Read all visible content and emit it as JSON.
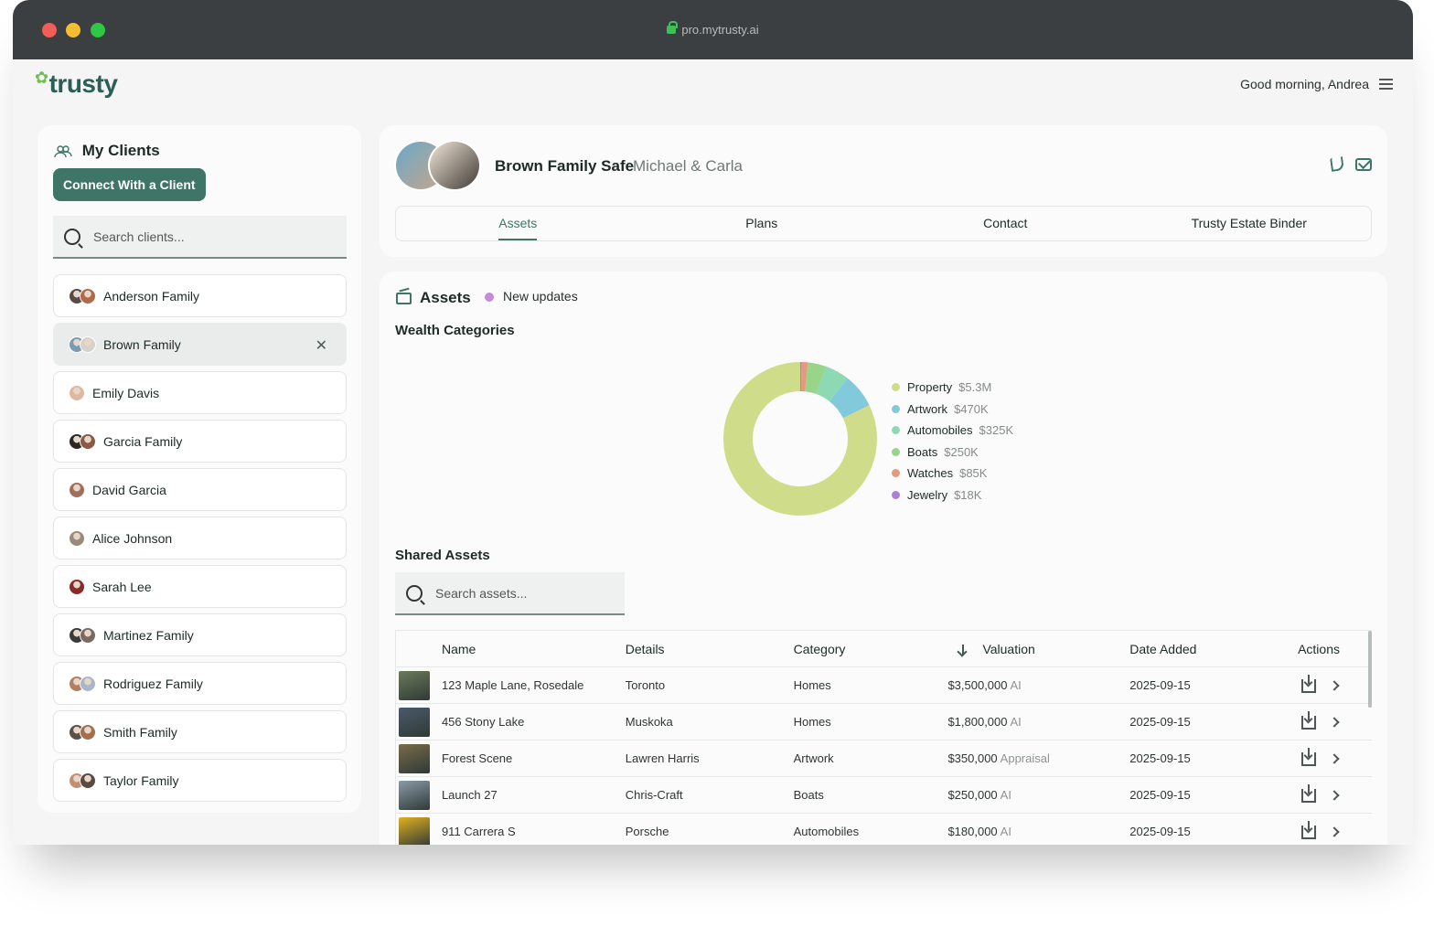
{
  "browser": {
    "url": "pro.mytrusty.ai"
  },
  "header": {
    "logo": "trusty",
    "greeting": "Good morning, Andrea"
  },
  "sidebar": {
    "title": "My Clients",
    "connect_label": "Connect With a Client",
    "search_placeholder": "Search clients...",
    "clients": [
      {
        "name": "Anderson Family",
        "avatars": [
          "#5a4a42",
          "#b06a4a"
        ]
      },
      {
        "name": "Brown Family",
        "avatars": [
          "#7b9bb0",
          "#d8d2c8"
        ],
        "active": true
      },
      {
        "name": "Emily Davis",
        "avatars": [
          "#e0b8a0"
        ]
      },
      {
        "name": "Garcia Family",
        "avatars": [
          "#2b2624",
          "#8a5a48"
        ]
      },
      {
        "name": "David Garcia",
        "avatars": [
          "#a0705a"
        ]
      },
      {
        "name": "Alice Johnson",
        "avatars": [
          "#9a8a7a"
        ]
      },
      {
        "name": "Sarah Lee",
        "avatars": [
          "#8a2a2a"
        ]
      },
      {
        "name": "Martinez Family",
        "avatars": [
          "#3a3a3a",
          "#7a6a60"
        ]
      },
      {
        "name": "Rodriguez Family",
        "avatars": [
          "#b08060",
          "#a8b8c8"
        ]
      },
      {
        "name": "Smith Family",
        "avatars": [
          "#5a5048",
          "#a07050"
        ]
      },
      {
        "name": "Taylor Family",
        "avatars": [
          "#c09070",
          "#5a4a40"
        ]
      }
    ]
  },
  "profile": {
    "title": "Brown Family Safe",
    "subtitle": "Michael & Carla",
    "tabs": [
      "Assets",
      "Plans",
      "Contact",
      "Trusty Estate Binder"
    ],
    "active_tab": "Assets"
  },
  "assets": {
    "title": "Assets",
    "badge": "New updates",
    "wealth_title": "Wealth Categories",
    "shared_title": "Shared Assets",
    "search_placeholder": "Search assets...",
    "columns": [
      "Name",
      "Details",
      "Category",
      "Valuation",
      "Date Added",
      "Actions"
    ],
    "rows": [
      {
        "name": "123 Maple Lane, Rosedale",
        "details": "Toronto",
        "category": "Homes",
        "valuation": "$3,500,000",
        "source": "AI",
        "date": "2025-09-15",
        "thumb": "#6b7a5a"
      },
      {
        "name": "456 Stony Lake",
        "details": "Muskoka",
        "category": "Homes",
        "valuation": "$1,800,000",
        "source": "AI",
        "date": "2025-09-15",
        "thumb": "#4a5a6a"
      },
      {
        "name": "Forest Scene",
        "details": "Lawren Harris",
        "category": "Artwork",
        "valuation": "$350,000",
        "source": "Appraisal",
        "date": "2025-09-15",
        "thumb": "#7a6a4a"
      },
      {
        "name": "Launch 27",
        "details": "Chris-Craft",
        "category": "Boats",
        "valuation": "$250,000",
        "source": "AI",
        "date": "2025-09-15",
        "thumb": "#8a9aa8"
      },
      {
        "name": "911 Carrera S",
        "details": "Porsche",
        "category": "Automobiles",
        "valuation": "$180,000",
        "source": "AI",
        "date": "2025-09-15",
        "thumb": "#e0b020"
      }
    ]
  },
  "chart_data": {
    "type": "pie",
    "categories": [
      "Property",
      "Artwork",
      "Automobiles",
      "Boats",
      "Watches",
      "Jewelry"
    ],
    "values": [
      5300000,
      470000,
      325000,
      250000,
      85000,
      18000
    ],
    "labels": [
      "$5.3M",
      "$470K",
      "$325K",
      "$250K",
      "$85K",
      "$18K"
    ],
    "colors": [
      "#cfdd8a",
      "#82c9dc",
      "#8dd9b3",
      "#98d58a",
      "#e69a7c",
      "#b07ed9"
    ],
    "legend_position": "right"
  }
}
